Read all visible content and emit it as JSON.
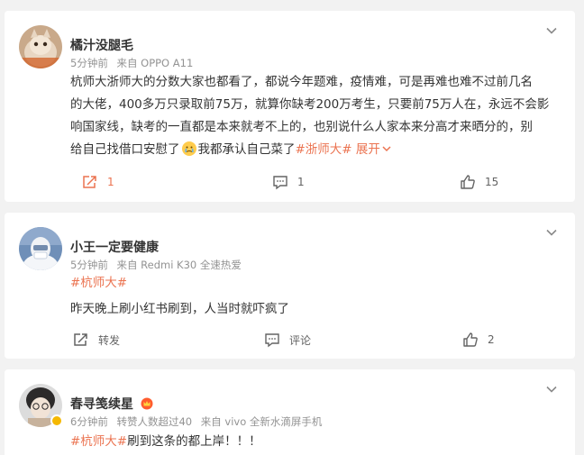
{
  "posts": [
    {
      "username": "橘汁没腿毛",
      "time": "5分钟前",
      "source": "来自 OPPO A11",
      "lines": [
        "杭师大浙师大的分数大家也都看了，都说今年题难，疫情难，可是再难也难不过前几名",
        "的大佬，400多万只录取前75万，就算你缺考200万考生，只要前75万人在，永远不会影",
        "响国家线，缺考的一直都是本来就考不上的，也别说什么人家本来分高才来晒分的，别"
      ],
      "last_line": "给自己找借口安慰了",
      "emoji": "crying-face-emoji",
      "last_line_tail": "我都承认自己菜了",
      "hashtag": "#浙师大#",
      "expand_label": "展开",
      "repost_count": "1",
      "comment_count": "1",
      "like_count": "15"
    },
    {
      "username": "小王一定要健康",
      "time": "5分钟前",
      "source": "来自 Redmi K30 全速热爱",
      "hashtag": "#杭师大#",
      "text": "昨天晚上刷小红书刷到，人当时就吓疯了",
      "repost_label": "转发",
      "comment_label": "评论",
      "like_count": "2"
    },
    {
      "username": "春寻笺续星",
      "time": "6分钟前",
      "forwarded": "转赞人数超过40",
      "source": "来自 vivo 全新水滴屏手机",
      "hashtag": "#杭师大#",
      "text": "刷到这条的都上岸！！！"
    }
  ],
  "colors": {
    "accent": "#eb7350",
    "meta": "#939393",
    "background": "#f2f2f2"
  }
}
